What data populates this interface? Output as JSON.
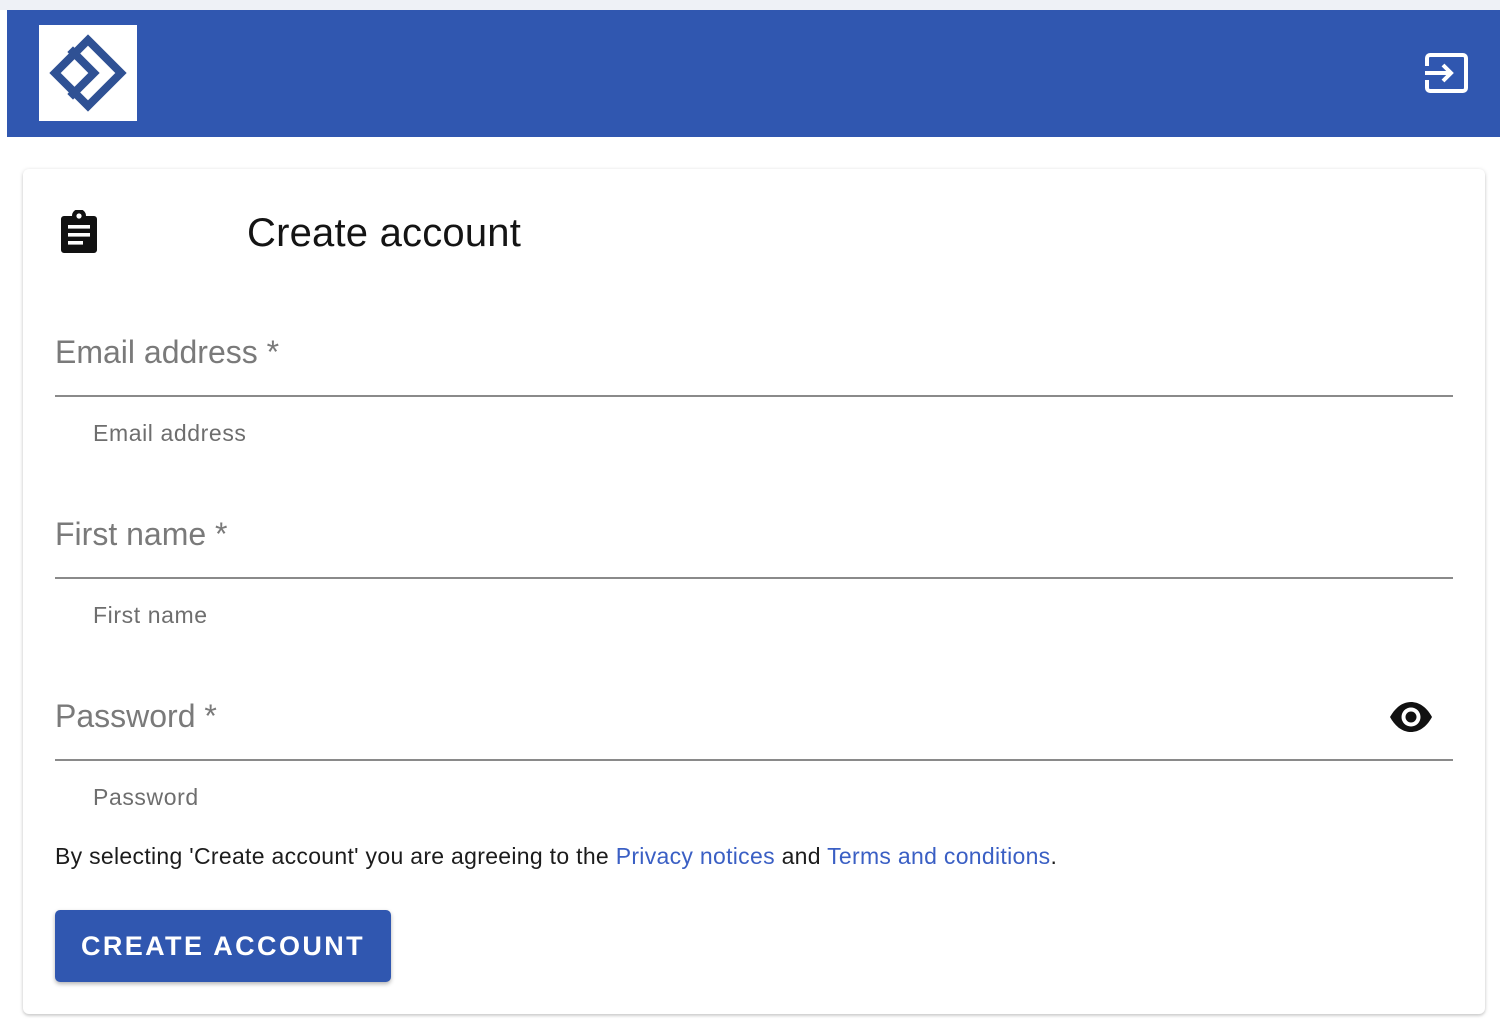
{
  "header": {
    "logo_icon": "diamond-chevron-logo-icon",
    "login_icon": "login-arrow-icon",
    "bar_color": "#3057b0"
  },
  "card": {
    "title": "Create account",
    "title_icon": "clipboard-icon"
  },
  "form": {
    "email": {
      "placeholder": "Email address *",
      "value": "",
      "helper": "Email address"
    },
    "first_name": {
      "placeholder": "First name *",
      "value": "",
      "helper": "First name"
    },
    "password": {
      "placeholder": "Password *",
      "value": "",
      "helper": "Password",
      "toggle_icon": "eye-icon"
    }
  },
  "agreement": {
    "prefix": "By selecting 'Create account' you are agreeing to the ",
    "privacy_link": "Privacy notices",
    "middle": " and ",
    "terms_link": "Terms and conditions",
    "suffix": "."
  },
  "actions": {
    "create_label": "Create account",
    "button_color": "#3057b0"
  },
  "colors": {
    "primary": "#3057b0",
    "link": "#3a5fc4"
  }
}
